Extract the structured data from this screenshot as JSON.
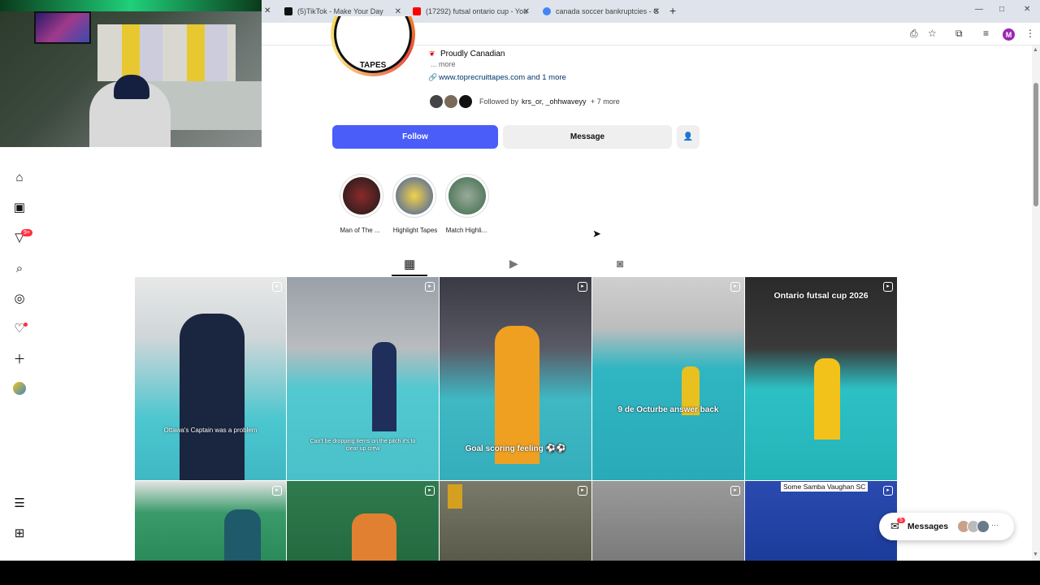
{
  "tabs": [
    {
      "label": "(5)TikTok - Make Your Day",
      "favicon_color": "#111111"
    },
    {
      "label": "(17292) futsal ontario cup - You",
      "favicon_color": "#ff0000"
    },
    {
      "label": "canada soccer bankruptcies - G",
      "favicon_color": "#4285f4"
    }
  ],
  "new_tab_label": "+",
  "profile_avatar_letter": "M",
  "profile": {
    "logo_text": "TAPES",
    "bio_line": "Proudly Canadian",
    "more_label": "... more",
    "link": "www.toprecruittapes.com and 1 more",
    "followed_by_prefix": "Followed by",
    "followed_by_names": "krs_or, _ohhwaveyy",
    "followed_by_more": "+ 7 more",
    "follow_label": "Follow",
    "message_label": "Message"
  },
  "highlights": [
    {
      "label": "Man of The ...",
      "color": "#3a2a2a"
    },
    {
      "label": "Highlight Tapes",
      "color": "#4a6aa8"
    },
    {
      "label": "Match Highli...",
      "color": "#5a7a5a"
    }
  ],
  "grid": [
    {
      "caption": "Ottawa's Captain was a problem",
      "color": "#4cc6cf"
    },
    {
      "caption": "Can't be dropping items on the pitch it's to clear up crew",
      "color": "#52c8d0"
    },
    {
      "caption": "Goal scoring feeling ⚽⚽",
      "color": "#3fb8c4"
    },
    {
      "caption": "9 de Octurbe answer back",
      "color": "#2fb6c2"
    },
    {
      "caption": "Ontario futsal cup 2026",
      "color": "#2cc0c4"
    },
    {
      "caption": "",
      "color": "#2a8a5a"
    },
    {
      "caption": "",
      "color": "#2f7a4e"
    },
    {
      "caption": "",
      "color": "#6a6a5a"
    },
    {
      "caption": "",
      "color": "#8a8a8a"
    },
    {
      "caption": "Some Samba Vaughan SC",
      "color": "#1c3c9c"
    }
  ],
  "messages": {
    "label": "Messages",
    "count": "5"
  },
  "nav_badge": "9+",
  "colors": {
    "follow": "#4a5df9",
    "accent": "#ff3040"
  }
}
